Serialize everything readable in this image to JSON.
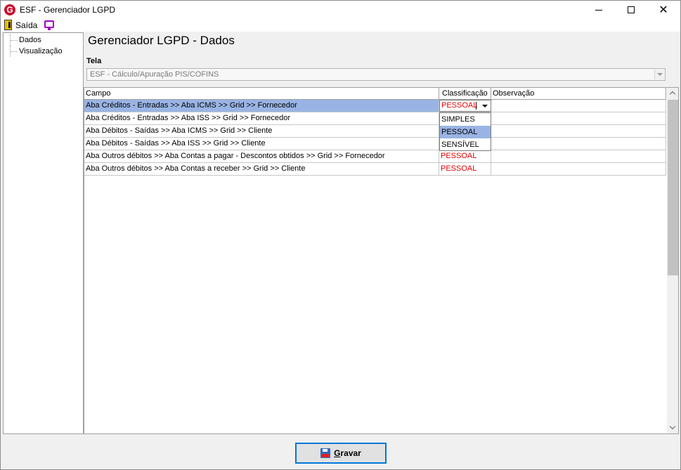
{
  "window": {
    "title": "ESF - Gerenciador LGPD",
    "app_icon_letter": "G"
  },
  "menu": {
    "exit_label": "Saída"
  },
  "tree": {
    "items": [
      {
        "label": "Dados"
      },
      {
        "label": "Visualização"
      }
    ]
  },
  "main": {
    "heading": "Gerenciador LGPD - Dados",
    "tela_label": "Tela",
    "tela_value": "ESF - Cálculo/Apuração PIS/COFINS"
  },
  "grid": {
    "columns": [
      "Campo",
      "Classificação",
      "Observação"
    ],
    "rows": [
      {
        "campo": "Aba Créditos - Entradas >> Aba ICMS >> Grid >> Fornecedor",
        "classificacao": "PESSOAL",
        "observacao": ""
      },
      {
        "campo": "Aba Créditos - Entradas >> Aba ISS >> Grid >> Fornecedor",
        "classificacao": "",
        "observacao": ""
      },
      {
        "campo": "Aba Débitos - Saídas >> Aba ICMS >> Grid >> Cliente",
        "classificacao": "",
        "observacao": ""
      },
      {
        "campo": "Aba Débitos - Saídas >> Aba ISS >> Grid >> Cliente",
        "classificacao": "",
        "observacao": ""
      },
      {
        "campo": "Aba Outros débitos >> Aba Contas a pagar - Descontos obtidos >> Grid >> Fornecedor",
        "classificacao": "PESSOAL",
        "observacao": ""
      },
      {
        "campo": "Aba Outros débitos >> Aba Contas a receber >> Grid >> Cliente",
        "classificacao": "PESSOAL",
        "observacao": ""
      }
    ],
    "editor_value": "PESSOAL",
    "dropdown_options": [
      "SIMPLES",
      "PESSOAL",
      "SENSÍVEL"
    ],
    "dropdown_highlighted": "PESSOAL"
  },
  "footer": {
    "save_label_first": "G",
    "save_label_rest": "ravar"
  },
  "colors": {
    "selection": "#99b4e4",
    "classification_text": "#e00000",
    "brand": "#c8102e"
  }
}
